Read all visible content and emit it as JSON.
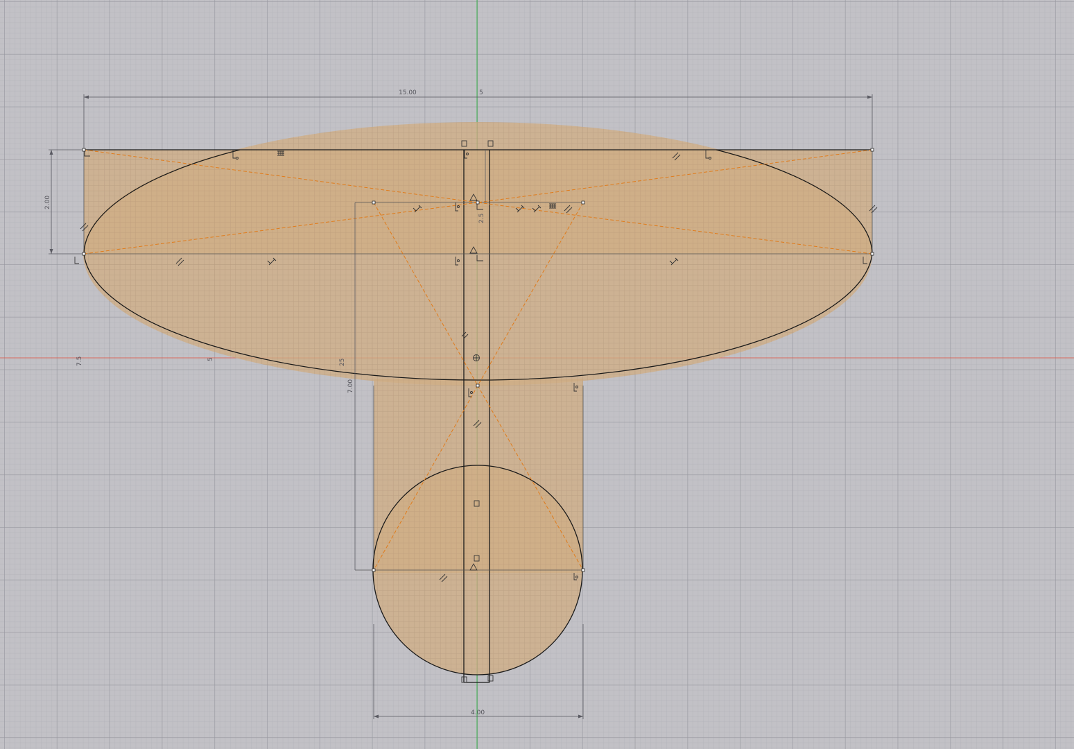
{
  "viewport": {
    "mode": "sketch-canvas",
    "colors": {
      "background": "#c2c1c6",
      "profile_fill": "#cfae86",
      "sketch_line": "#1a1a1a",
      "construction_line": "#e07b1a",
      "x_axis": "#e05545",
      "y_axis": "#37b34a",
      "dimension": "#5a5a62"
    }
  },
  "dimensions": {
    "overall_width": "15.00",
    "top_offset": "5",
    "left_height": "2.00",
    "upper_small": "2.5",
    "stem_height": "7.00",
    "left_75": "7.5",
    "left_5": "5",
    "mid_25": "25",
    "circle_width": "4.00"
  },
  "constraint_icons": [
    "fix-icon",
    "parallel-icon",
    "perpendicular-icon",
    "tangent-icon",
    "coincident-icon",
    "midpoint-icon",
    "horizontal-icon",
    "equal-icon",
    "symmetry-icon",
    "origin-icon"
  ]
}
